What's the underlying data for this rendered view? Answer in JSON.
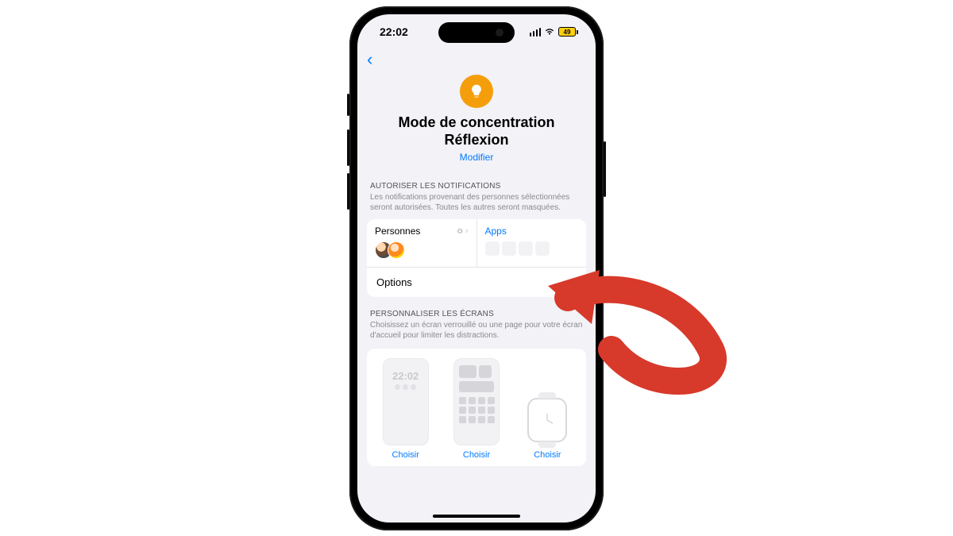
{
  "status": {
    "time": "22:02",
    "battery": "49"
  },
  "nav": {
    "back_glyph": "‹"
  },
  "hero": {
    "title_line1": "Mode de concentration",
    "title_line2": "Réflexion",
    "edit": "Modifier"
  },
  "notifications": {
    "header": "AUTORISER LES NOTIFICATIONS",
    "desc": "Les notifications provenant des personnes sélectionnées seront autorisées. Toutes les autres seront masquées.",
    "people_label": "Personnes",
    "apps_label": "Apps",
    "options_label": "Options"
  },
  "screens": {
    "header": "PERSONNALISER LES ÉCRANS",
    "desc": "Choisissez un écran verrouillé ou une page pour votre écran d'accueil pour limiter les distractions.",
    "lock_time": "22:02",
    "choose": "Choisir"
  },
  "icons": {
    "bulb": "lightbulb-icon",
    "gear": "gear-icon",
    "chevron": "chevron-right-icon"
  },
  "colors": {
    "accent": "#007aff",
    "focus_orange": "#f59e0b",
    "arrow": "#d7392b"
  }
}
